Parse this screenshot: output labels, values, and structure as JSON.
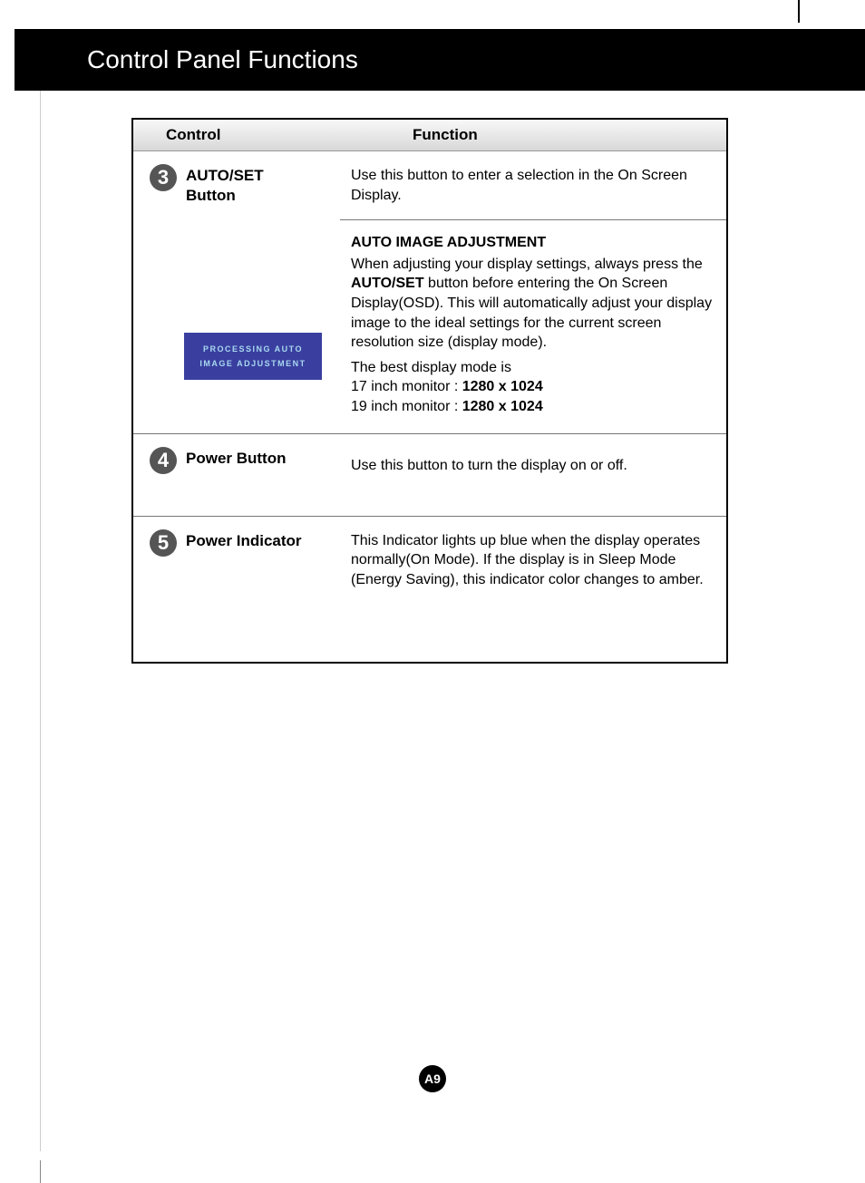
{
  "header": {
    "title": "Control Panel Functions"
  },
  "columns": {
    "control": "Control",
    "function": "Function"
  },
  "rows": [
    {
      "num": "3",
      "control_label": "AUTO/SET Button",
      "function_main": "Use this button to enter a selection in the On Screen Display.",
      "sub": {
        "heading": "AUTO IMAGE ADJUSTMENT",
        "text_pre": "When adjusting your display settings, always press the ",
        "text_bold": "AUTO/SET",
        "text_post": " button before entering the On Screen Display(OSD). This will automatically adjust your display image to the ideal settings for the current screen resolution size (display mode).",
        "best_mode": "The best display mode is",
        "res17_pre": "17 inch monitor : ",
        "res17_val": "1280 x 1024",
        "res19_pre": "19 inch monitor : ",
        "res19_val": "1280 x 1024",
        "osd_line1": "PROCESSING AUTO",
        "osd_line2": "IMAGE ADJUSTMENT"
      }
    },
    {
      "num": "4",
      "control_label": "Power Button",
      "function_main": "Use this button to turn the display on or off."
    },
    {
      "num": "5",
      "control_label": "Power Indicator",
      "function_main": "This Indicator lights up blue when the display operates normally(On Mode). If the display is in Sleep Mode (Energy Saving), this indicator color changes to amber."
    }
  ],
  "page_number": "A9"
}
